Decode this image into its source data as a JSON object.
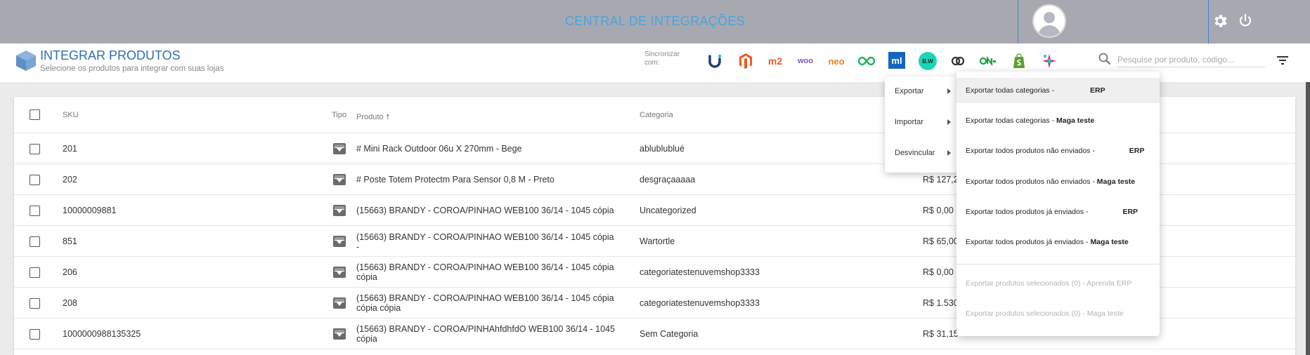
{
  "topbar": {
    "title": "CENTRAL DE INTEGRAÇÕES"
  },
  "header": {
    "title": "INTEGRAR PRODUTOS",
    "subtitle": "Selecione os produtos para integrar com suas lojas",
    "sync_label": "Sincronizar com:",
    "marketplace_icons": [
      "u-icon",
      "magento-icon",
      "magento2-icon",
      "woo-icon",
      "neo-icon",
      "infinity-icon",
      "ml-icon",
      "bw-icon",
      "link-icon",
      "on-icon",
      "shopify-icon",
      "star-icon"
    ],
    "mk_labels": {
      "m2": "m2",
      "woo": "woo",
      "neo": "neo",
      "ml": "ml",
      "bw": "B.W"
    },
    "search_placeholder": "Pesquise por produto, código..."
  },
  "table": {
    "headers": {
      "sku": "SKU",
      "tipo": "Tipo",
      "produto": "Produto",
      "sort_arrow": "↑",
      "categoria": "Categoria"
    },
    "rows": [
      {
        "sku": "201",
        "produto": "# Mini Rack Outdoor 06u X 270mm - Bege",
        "categoria": "ablublublué",
        "preco": ""
      },
      {
        "sku": "202",
        "produto": "# Poste Totem Protectm Para Sensor 0,8 M - Preto",
        "categoria": "desgraçaaaaa",
        "preco": "R$ 127,2"
      },
      {
        "sku": "10000009881",
        "produto": "(15663) BRANDY - COROA/PINHAO WEB100 36/14 - 1045 cópia",
        "categoria": "Uncategorized",
        "preco": "R$ 0,00"
      },
      {
        "sku": "851",
        "produto": "(15663) BRANDY - COROA/PINHAO WEB100 36/14 - 1045 cópia\n-",
        "categoria": "Wartortle",
        "preco": "R$ 65,00"
      },
      {
        "sku": "206",
        "produto": "(15663) BRANDY - COROA/PINHAO WEB100 36/14 - 1045 cópia\ncópia",
        "categoria": "categoriatestenuvemshop3333",
        "preco": "R$ 0,00"
      },
      {
        "sku": "208",
        "produto": "(15663) BRANDY - COROA/PINHAO WEB100 36/14 - 1045 cópia\ncópia cópia",
        "categoria": "categoriatestenuvemshop3333",
        "preco": "R$ 1.530"
      },
      {
        "sku": "1000000988135325",
        "produto": "(15663) BRANDY - COROA/PINHAhfdhfdO WEB100 36/14 - 1045\ncópia",
        "categoria": "Sem Categoria",
        "preco": "R$ 31,15"
      }
    ]
  },
  "menu": {
    "items": [
      {
        "label": "Exportar"
      },
      {
        "label": "Importar"
      },
      {
        "label": "Desvincular"
      }
    ]
  },
  "submenu": {
    "items": [
      {
        "text": "Exportar todas categorias - ",
        "bold": "ERP"
      },
      {
        "text": "Exportar todas categorias - ",
        "bold": "Maga teste"
      },
      {
        "text": "Exportar todos produtos não enviados - ",
        "bold": "ERP"
      },
      {
        "text": "Exportar todos produtos não enviados - ",
        "bold": "Maga teste"
      },
      {
        "text": "Exportar todos produtos já enviados - ",
        "bold": "ERP"
      },
      {
        "text": "Exportar todos produtos já enviados - ",
        "bold": "Maga teste"
      },
      {
        "text": "Exportar produtos selecionados (0) - Aprenda ERP",
        "bold": ""
      },
      {
        "text": "Exportar produtos selecionados (0) - Maga teste",
        "bold": ""
      }
    ]
  },
  "colors": {
    "topbar": "#a8a9b0",
    "accent": "#2f6db5",
    "title_blue": "#4aa3df"
  }
}
